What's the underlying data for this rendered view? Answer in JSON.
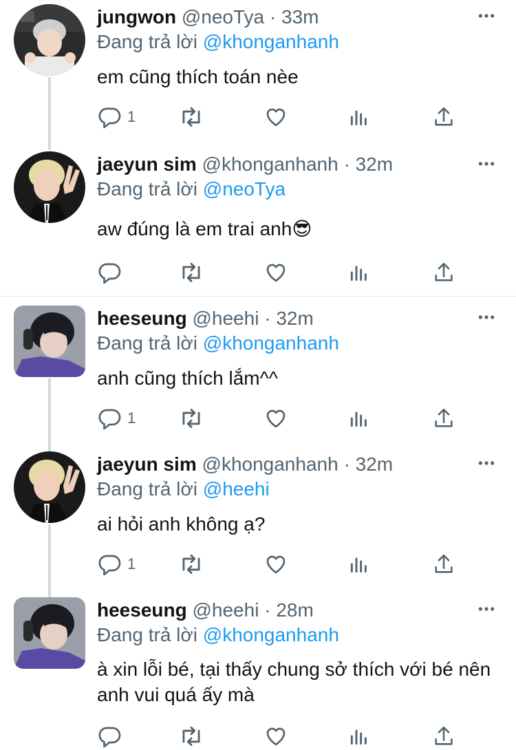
{
  "colors": {
    "link": "#1d9bf0",
    "muted": "#536471",
    "text": "#0f1419",
    "thread_line": "#cfd9de"
  },
  "icons": [
    "reply-icon",
    "retweet-icon",
    "like-icon",
    "analytics-icon",
    "share-icon",
    "more-icon"
  ],
  "tweets": [
    {
      "name": "jungwon",
      "handle": "@neoTya",
      "sep": "·",
      "time": "33m",
      "reply_prefix": "Đang trả lời",
      "reply_to": "@khonganhanh",
      "text": "em cũng thích toán nèe",
      "reply_count": "1"
    },
    {
      "name": "jaeyun sim",
      "handle": "@khonganhanh",
      "sep": "·",
      "time": "32m",
      "reply_prefix": "Đang trả lời",
      "reply_to": "@neoTya",
      "text": "aw đúng là em trai anh",
      "emoji": "😎",
      "reply_count": ""
    },
    {
      "name": "heeseung",
      "handle": "@heehi",
      "sep": "·",
      "time": "32m",
      "reply_prefix": "Đang trả lời",
      "reply_to": "@khonganhanh",
      "text": "anh cũng thích lắm^^",
      "reply_count": "1"
    },
    {
      "name": "jaeyun sim",
      "handle": "@khonganhanh",
      "sep": "·",
      "time": "32m",
      "reply_prefix": "Đang trả lời",
      "reply_to": "@heehi",
      "text": "ai hỏi anh không ạ?",
      "reply_count": "1"
    },
    {
      "name": "heeseung",
      "handle": "@heehi",
      "sep": "·",
      "time": "28m",
      "reply_prefix": "Đang trả lời",
      "reply_to": "@khonganhanh",
      "text": "à xin lỗi bé, tại thấy chung sở thích với bé nên anh vui quá ấy mà",
      "reply_count": ""
    }
  ]
}
